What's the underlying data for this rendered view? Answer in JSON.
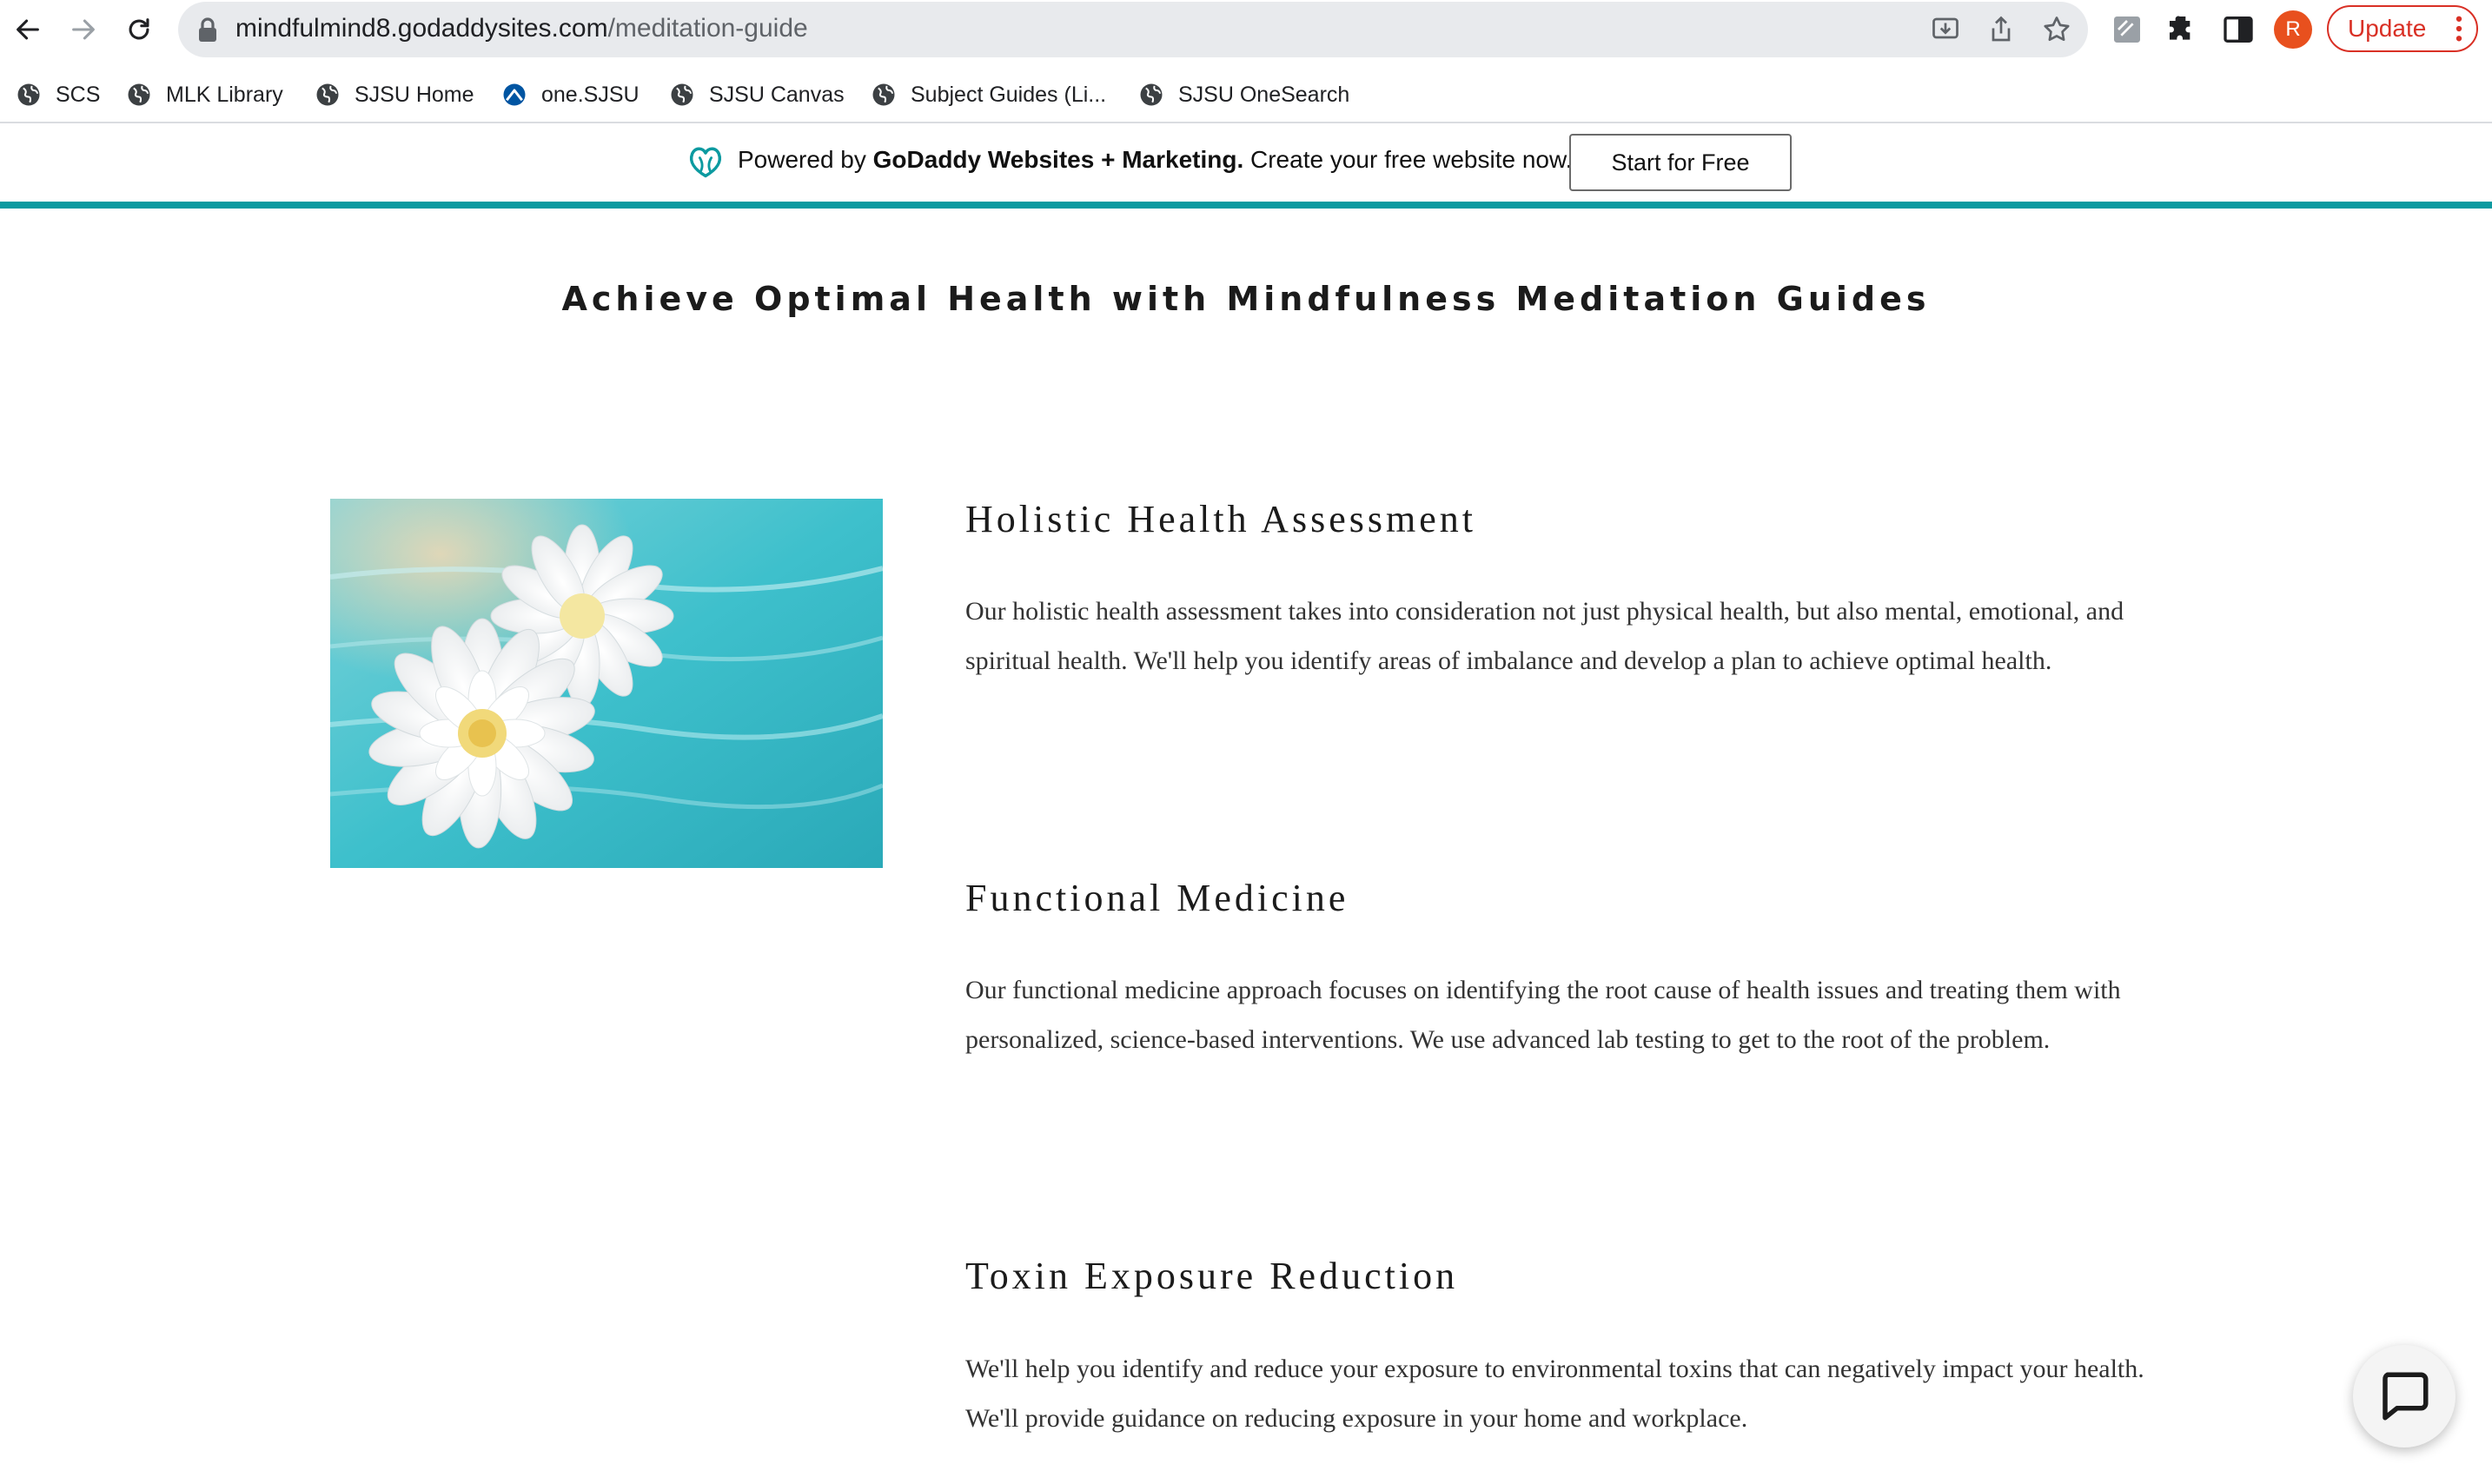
{
  "browser": {
    "url_host": "mindfulmind8.godaddysites.com",
    "url_path": "/meditation-guide",
    "avatar_letter": "R",
    "update_label": "Update"
  },
  "bookmarks": [
    {
      "label": "SCS",
      "icon": "globe-icon"
    },
    {
      "label": "MLK Library",
      "icon": "globe-icon"
    },
    {
      "label": "SJSU Home",
      "icon": "globe-icon"
    },
    {
      "label": "one.SJSU",
      "icon": "sjsu-icon"
    },
    {
      "label": "SJSU Canvas",
      "icon": "globe-icon"
    },
    {
      "label": "Subject Guides (Li...",
      "icon": "globe-icon"
    },
    {
      "label": "SJSU OneSearch",
      "icon": "globe-icon"
    }
  ],
  "banner": {
    "prefix": "Powered by ",
    "brand": "GoDaddy Websites + Marketing.",
    "suffix": " Create your free website now.",
    "cta_label": "Start for Free",
    "accent_color": "#0c9aa0"
  },
  "page": {
    "title": "Achieve Optimal Health with Mindfulness Meditation Guides",
    "sections": [
      {
        "heading": "Holistic Health Assessment",
        "body": "Our holistic health assessment takes into consideration not just physical health, but also mental, emotional, and spiritual health. We'll help you identify areas of imbalance and develop a plan to achieve optimal health."
      },
      {
        "heading": "Functional Medicine",
        "body": "Our functional medicine approach focuses on identifying the root cause of health issues and treating them with personalized, science-based interventions. We use advanced lab testing to get to the root of the problem."
      },
      {
        "heading": "Toxin Exposure Reduction",
        "body": "We'll help you identify and reduce your exposure to environmental toxins that can negatively impact your health. We'll provide guidance on reducing exposure in your home and workplace."
      }
    ]
  }
}
